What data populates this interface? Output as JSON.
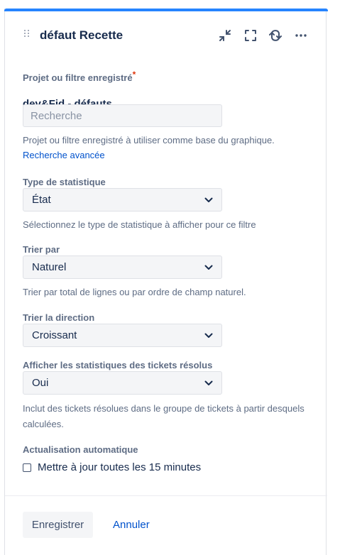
{
  "header": {
    "title": "défaut Recette",
    "icons": [
      "drag-handle-icon",
      "minimize-icon",
      "fullscreen-icon",
      "refresh-icon",
      "more-icon"
    ]
  },
  "project": {
    "label": "Projet ou filtre enregistré",
    "required_mark": "*",
    "selected_value": "dev&Fid - défauts",
    "search_placeholder": "Recherche",
    "help": "Projet ou filtre enregistré à utiliser comme base du graphique.",
    "advanced_link": "Recherche avancée"
  },
  "statistic_type": {
    "label": "Type de statistique",
    "value": "État",
    "help": "Sélectionnez le type de statistique à afficher pour ce filtre"
  },
  "sort_by": {
    "label": "Trier par",
    "value": "Naturel",
    "help": "Trier par total de lignes ou par ordre de champ naturel."
  },
  "sort_direction": {
    "label": "Trier la direction",
    "value": "Croissant"
  },
  "resolved_stats": {
    "label": "Afficher les statistiques des tickets résolus",
    "value": "Oui",
    "help_line1": "Inclut des tickets résolues dans le groupe de tickets à partir desquels",
    "help_line2": "calculées."
  },
  "auto_refresh": {
    "label": "Actualisation automatique",
    "checkbox_label": "Mettre à jour toutes les 15 minutes",
    "checked": false
  },
  "actions": {
    "save": "Enregistrer",
    "cancel": "Annuler"
  },
  "colors": {
    "accent": "#2684ff",
    "link": "#0052cc",
    "required": "#de350b"
  }
}
